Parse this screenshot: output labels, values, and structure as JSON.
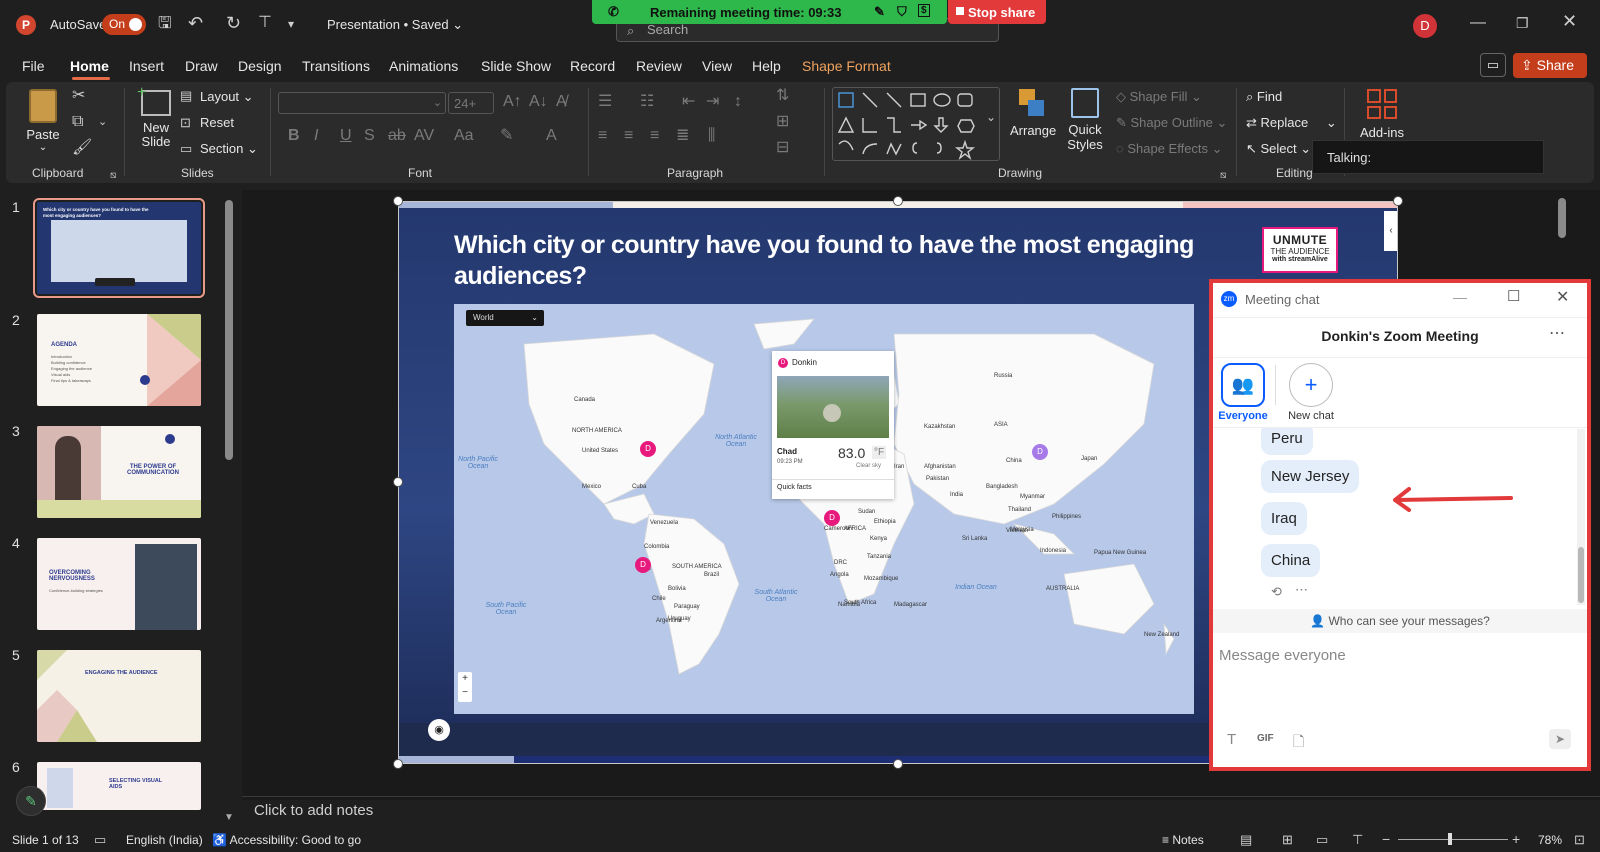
{
  "titlebar": {
    "autosave": "AutoSave",
    "toggle": "On",
    "doc": "Presentation • Saved",
    "search": "Search",
    "user_initial": "D"
  },
  "zoom_banner": {
    "remaining": "Remaining meeting time: 09:33",
    "stop": "Stop share"
  },
  "menu": [
    "File",
    "Home",
    "Insert",
    "Draw",
    "Design",
    "Transitions",
    "Animations",
    "Slide Show",
    "Record",
    "Review",
    "View",
    "Help",
    "Shape Format"
  ],
  "share": "Share",
  "ribbon": {
    "paste": "Paste",
    "new_slide": "New Slide",
    "layout": "Layout",
    "reset": "Reset",
    "section": "Section",
    "font_size": "24+",
    "arrange": "Arrange",
    "quick_styles": "Quick Styles",
    "shape_fill": "Shape Fill",
    "shape_outline": "Shape Outline",
    "shape_effects": "Shape Effects",
    "find": "Find",
    "replace": "Replace",
    "select": "Select",
    "addins": "Add-ins",
    "talking": "Talking:",
    "groups": {
      "clipboard": "Clipboard",
      "slides": "Slides",
      "font": "Font",
      "paragraph": "Paragraph",
      "drawing": "Drawing",
      "editing": "Editing"
    }
  },
  "thumbs": [
    {
      "n": "1",
      "title": "Which city or country have you found to have the most engaging audiences?"
    },
    {
      "n": "2",
      "title": "AGENDA",
      "lines": [
        "Introduction",
        "Building confidence",
        "Engaging the audience",
        "Visual aids",
        "Final tips & takeaways"
      ]
    },
    {
      "n": "3",
      "title": "THE POWER OF COMMUNICATION"
    },
    {
      "n": "4",
      "title": "OVERCOMING NERVOUSNESS",
      "sub": "Confidence-building strategies"
    },
    {
      "n": "5",
      "title": "ENGAGING THE AUDIENCE"
    },
    {
      "n": "6",
      "title": "SELECTING VISUAL AIDS"
    }
  ],
  "slide": {
    "title": "Which city or country have you found to have the most engaging audiences?",
    "logo1": "UNMUTE",
    "logo2": "THE AUDIENCE",
    "logo3": "with streamAlive",
    "map_select": "World",
    "labels": [
      {
        "t": "Canada"
      },
      {
        "t": "NORTH AMERICA"
      },
      {
        "t": "United States"
      },
      {
        "t": "Mexico"
      },
      {
        "t": "Cuba"
      },
      {
        "t": "Venezuela"
      },
      {
        "t": "Colombia"
      },
      {
        "t": "Peru"
      },
      {
        "t": "SOUTH AMERICA"
      },
      {
        "t": "Brazil"
      },
      {
        "t": "Bolivia"
      },
      {
        "t": "Chile"
      },
      {
        "t": "Paraguay"
      },
      {
        "t": "Uruguay"
      },
      {
        "t": "Argentina"
      },
      {
        "t": "Russia"
      },
      {
        "t": "Kazakhstan"
      },
      {
        "t": "ASIA"
      },
      {
        "t": "China"
      },
      {
        "t": "Japan"
      },
      {
        "t": "Afghanistan"
      },
      {
        "t": "Iran"
      },
      {
        "t": "Pakistan"
      },
      {
        "t": "India"
      },
      {
        "t": "Bangladesh"
      },
      {
        "t": "Myanmar"
      },
      {
        "t": "Thailand"
      },
      {
        "t": "Vietnam"
      },
      {
        "t": "Philippines"
      },
      {
        "t": "Malaysia"
      },
      {
        "t": "Indonesia"
      },
      {
        "t": "Papua New Guinea"
      },
      {
        "t": "Sri Lanka"
      },
      {
        "t": "AUSTRALIA"
      },
      {
        "t": "New Zealand"
      },
      {
        "t": "Sudan"
      },
      {
        "t": "Ethiopia"
      },
      {
        "t": "Kenya"
      },
      {
        "t": "Tanzania"
      },
      {
        "t": "Cameroon"
      },
      {
        "t": "AFRICA"
      },
      {
        "t": "DRC"
      },
      {
        "t": "Angola"
      },
      {
        "t": "Namibia"
      },
      {
        "t": "Mozambique"
      },
      {
        "t": "South Africa"
      },
      {
        "t": "Madagascar"
      },
      {
        "t": "North Atlantic Ocean"
      },
      {
        "t": "North Pacific Ocean"
      },
      {
        "t": "South Pacific Ocean"
      },
      {
        "t": "South Atlantic Ocean"
      },
      {
        "t": "Indian Ocean"
      }
    ],
    "pin": "D",
    "popup": {
      "user": "Donkin",
      "place": "Chad",
      "time": "09:23 PM",
      "temp": "83.0",
      "unit": "°F",
      "weather": "Clear sky",
      "facts": "Quick facts"
    }
  },
  "chat": {
    "header": "Meeting chat",
    "meeting": "Donkin's Zoom Meeting",
    "everyone": "Everyone",
    "new_chat": "New chat",
    "messages": [
      "Peru",
      "New Jersey",
      "Iraq",
      "China"
    ],
    "who": "Who can see your messages?",
    "placeholder": "Message everyone",
    "gif": "GIF"
  },
  "notes": "Click to add notes",
  "status": {
    "slide": "Slide 1 of 13",
    "lang": "English (India)",
    "access": "Accessibility: Good to go",
    "notes": "Notes",
    "zoom": "78%"
  },
  "colors": {
    "accent": "#c43e1c",
    "chat_border": "#e23a3a",
    "zoom_green": "#2eb84b",
    "pin": "#e8197d"
  }
}
